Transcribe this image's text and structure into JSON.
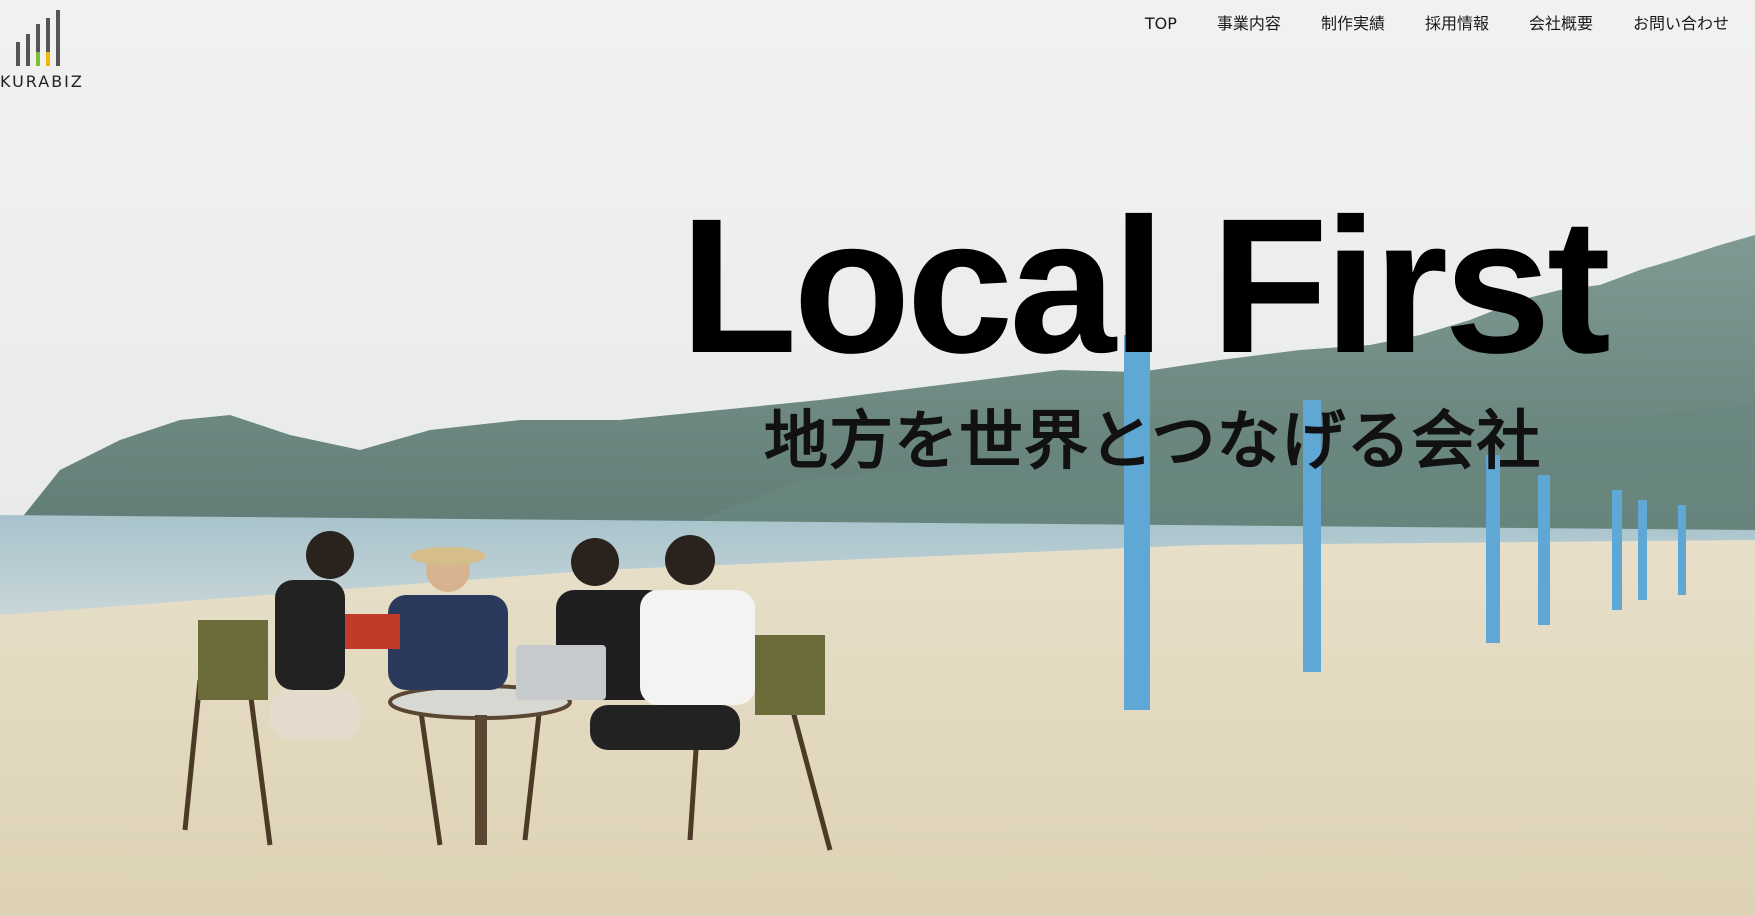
{
  "brand": {
    "name": "KURABIZ",
    "colors": {
      "bars": "#555555",
      "bar_green": "#7bbf3a",
      "bar_yellow": "#f2b705"
    }
  },
  "nav": {
    "items": [
      {
        "label": "TOP"
      },
      {
        "label": "事業内容"
      },
      {
        "label": "制作実績"
      },
      {
        "label": "採用情報"
      },
      {
        "label": "会社概要"
      },
      {
        "label": "お問い合わせ"
      }
    ]
  },
  "hero": {
    "headline": "Local First",
    "subheadline": "地方を世界とつなげる会社",
    "image_subject": "people-at-table-on-beach"
  }
}
